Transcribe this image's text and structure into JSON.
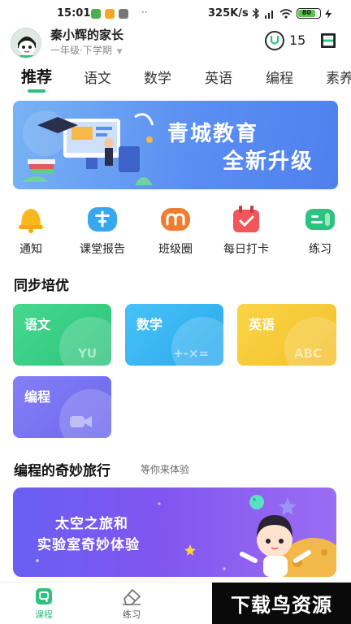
{
  "status_bar": {
    "time": "15:01",
    "network_speed": "325K/s",
    "battery": "80",
    "more_dots": "··"
  },
  "header": {
    "username": "秦小辉的家长",
    "grade": "一年级·下学期",
    "coin_count": "15"
  },
  "tabs": [
    "推荐",
    "语文",
    "数学",
    "英语",
    "编程",
    "素养"
  ],
  "active_tab": "推荐",
  "banner": {
    "line1": "青城教育",
    "line2": "全新升级"
  },
  "quick_actions": [
    {
      "label": "通知",
      "icon": "bell-icon",
      "color": "#f9b91e"
    },
    {
      "label": "课堂报告",
      "icon": "report-icon",
      "color": "#37a8ef"
    },
    {
      "label": "班级圈",
      "icon": "class-circle-icon",
      "color": "#f07c2f"
    },
    {
      "label": "每日打卡",
      "icon": "calendar-check-icon",
      "color": "#f0565a"
    },
    {
      "label": "练习",
      "icon": "practice-icon",
      "color": "#2ec27e"
    }
  ],
  "sync_section": {
    "title": "同步培优",
    "cards": [
      {
        "label": "语文",
        "deco": "YU",
        "color": "#3fd38a"
      },
      {
        "label": "数学",
        "deco": "+-×=",
        "color": "#3ab6f3"
      },
      {
        "label": "英语",
        "deco": "ABC",
        "color": "#f7c93a"
      },
      {
        "label": "编程",
        "deco": "",
        "color": "#7a72f2"
      }
    ]
  },
  "travel_section": {
    "title": "编程的奇妙旅行",
    "subtitle": "等你来体验",
    "promo_line1": "太空之旅和",
    "promo_line2": "实验室奇妙体验"
  },
  "bottom_nav": [
    {
      "label": "课程",
      "icon": "course-icon",
      "active": true
    },
    {
      "label": "练习",
      "icon": "eraser-icon",
      "active": false
    }
  ],
  "watermark": "下载鸟资源",
  "colors": {
    "accent": "#2ec27e",
    "banner_blue": "#5b8ef2",
    "promo_purple": "#7a5cf1"
  }
}
